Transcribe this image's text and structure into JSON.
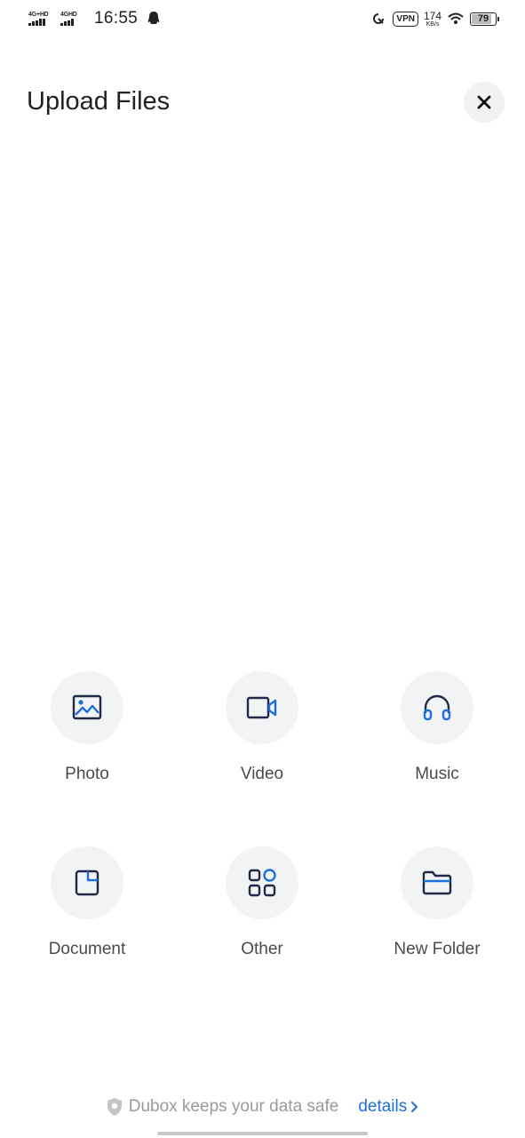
{
  "status_bar": {
    "sim1_label": "4G+HD",
    "sim2_label": "4GHD",
    "time": "16:55",
    "vpn": "VPN",
    "speed_value": "174",
    "speed_unit": "KB/s",
    "battery": "79",
    "battery_level": 0.79
  },
  "header": {
    "title": "Upload Files"
  },
  "options": [
    {
      "label": "Photo",
      "icon": "image-icon"
    },
    {
      "label": "Video",
      "icon": "video-camera-icon"
    },
    {
      "label": "Music",
      "icon": "headphones-icon"
    },
    {
      "label": "Document",
      "icon": "document-icon"
    },
    {
      "label": "Other",
      "icon": "apps-grid-icon"
    },
    {
      "label": "New Folder",
      "icon": "folder-icon"
    }
  ],
  "footer": {
    "safe_text": "Dubox keeps your data safe",
    "details_label": "details"
  },
  "colors": {
    "accent": "#1e6fd9",
    "icon_dark": "#1f2a44",
    "circle_bg": "#f2f3f5"
  }
}
